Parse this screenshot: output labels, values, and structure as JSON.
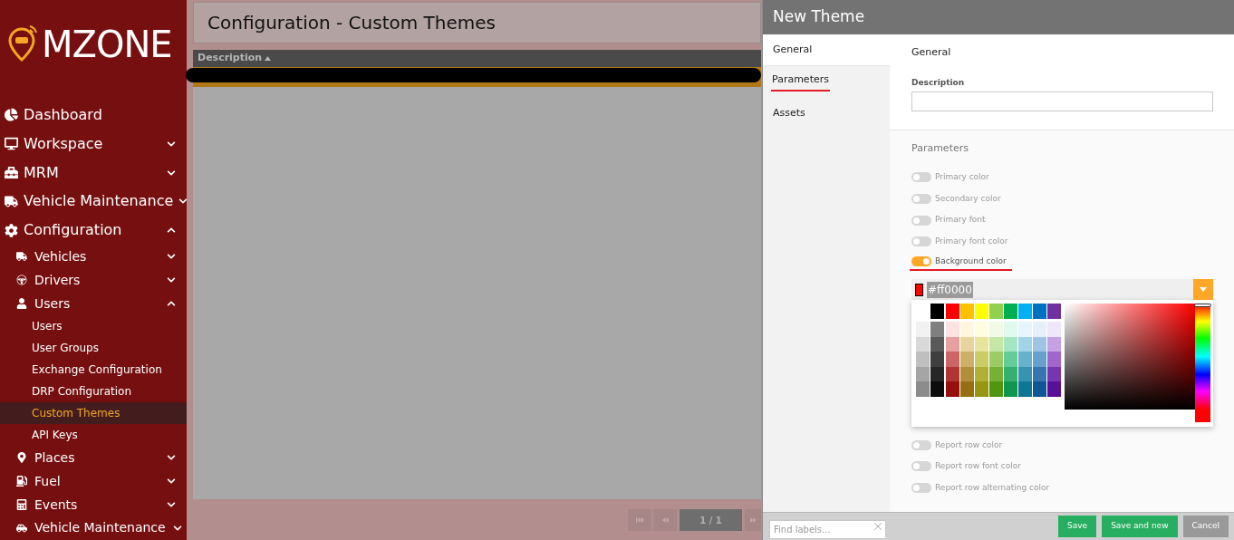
{
  "logo": {
    "text": "MZONE"
  },
  "sidebar": {
    "items": [
      {
        "label": "Dashboard",
        "selected": false
      },
      {
        "label": "Workspace",
        "expanded": false,
        "selected": false
      },
      {
        "label": "MRM",
        "expanded": false,
        "selected": false
      },
      {
        "label": "Vehicle Maintenance",
        "expanded": false,
        "selected": false
      },
      {
        "label": "Configuration",
        "expanded": true,
        "selected": false,
        "children": [
          {
            "label": "Vehicles",
            "expanded": false,
            "selected": false
          },
          {
            "label": "Drivers",
            "expanded": false,
            "selected": false
          },
          {
            "label": "Users",
            "expanded": true,
            "selected": false,
            "children": [
              {
                "label": "Users",
                "selected": false
              },
              {
                "label": "User Groups",
                "selected": false
              },
              {
                "label": "Exchange Configuration",
                "selected": false
              },
              {
                "label": "DRP Configuration",
                "selected": false
              },
              {
                "label": "Custom Themes",
                "selected": true
              },
              {
                "label": "API Keys",
                "selected": false
              }
            ]
          },
          {
            "label": "Places",
            "expanded": false,
            "selected": false
          },
          {
            "label": "Fuel",
            "expanded": false,
            "selected": false
          },
          {
            "label": "Events",
            "expanded": false,
            "selected": false
          },
          {
            "label": "Vehicle Maintenance",
            "expanded": false,
            "selected": false
          }
        ]
      }
    ]
  },
  "page": {
    "title": "Configuration - Custom Themes",
    "table": {
      "columns": [
        {
          "label": "Description",
          "sorted": true
        }
      ]
    },
    "pagination": {
      "page": "1 / 1"
    }
  },
  "dialog": {
    "title": "New Theme",
    "tabs": [
      {
        "label": "General",
        "selected": true,
        "underlined": false
      },
      {
        "label": "Parameters",
        "selected": false,
        "underlined": true
      },
      {
        "label": "Assets",
        "selected": false,
        "underlined": false
      }
    ],
    "general": {
      "heading": "General",
      "description": {
        "label": "Description"
      }
    },
    "parameters": {
      "heading": "Parameters",
      "items": [
        {
          "label": "Primary color",
          "on": false,
          "underlined": false
        },
        {
          "label": "Secondary color",
          "on": false,
          "underlined": false
        },
        {
          "label": "Primary font",
          "on": false,
          "underlined": false
        },
        {
          "label": "Primary font color",
          "on": false,
          "underlined": false
        },
        {
          "label": "Background color",
          "on": true,
          "underlined": true,
          "picker": {
            "value": "#ff0000",
            "hue": {
              "level": 0
            },
            "palette": [
              [
                {
                  "color": "#000000"
                },
                {
                  "color": "#ff0000"
                },
                {
                  "color": "#ffc000"
                },
                {
                  "color": "#ffff00"
                },
                {
                  "color": "#92d050"
                },
                {
                  "color": "#00b050"
                },
                {
                  "color": "#00b0f0"
                },
                {
                  "color": "#0070c0"
                },
                {
                  "color": "#7030a0"
                }
              ],
              [
                {
                  "color": "#f2f2f2"
                },
                {
                  "color": "#7f7f7f"
                },
                {
                  "color": "#fde2e2"
                },
                {
                  "color": "#fff6e0"
                },
                {
                  "color": "#fffde0"
                },
                {
                  "color": "#f0fae6"
                },
                {
                  "color": "#e0faee"
                },
                {
                  "color": "#e6f6fc"
                },
                {
                  "color": "#e6f0fa"
                },
                {
                  "color": "#f0e6fa"
                }
              ],
              [
                {
                  "color": "#d9d9d9"
                },
                {
                  "color": "#595959"
                },
                {
                  "color": "#e6a0a0"
                },
                {
                  "color": "#e8d49e"
                },
                {
                  "color": "#e6e59e"
                },
                {
                  "color": "#c6e6a4"
                },
                {
                  "color": "#a4e6c4"
                },
                {
                  "color": "#a0d4e6"
                },
                {
                  "color": "#a0c4e4"
                },
                {
                  "color": "#c8a0e4"
                }
              ],
              [
                {
                  "color": "#bfbfbf"
                },
                {
                  "color": "#3f3f3f"
                },
                {
                  "color": "#cc6666"
                },
                {
                  "color": "#ccb066"
                },
                {
                  "color": "#cccc66"
                },
                {
                  "color": "#9ccc66"
                },
                {
                  "color": "#66cc96"
                },
                {
                  "color": "#66b2cc"
                },
                {
                  "color": "#66a0cc"
                },
                {
                  "color": "#a066cc"
                }
              ],
              [
                {
                  "color": "#a5a5a5"
                },
                {
                  "color": "#262626"
                },
                {
                  "color": "#b03636"
                },
                {
                  "color": "#b08f36"
                },
                {
                  "color": "#b0b036"
                },
                {
                  "color": "#76b036"
                },
                {
                  "color": "#36b06e"
                },
                {
                  "color": "#3694b0"
                },
                {
                  "color": "#3676b0"
                },
                {
                  "color": "#7636b0"
                }
              ],
              [
                {
                  "color": "#8c8c8c"
                },
                {
                  "color": "#0c0c0c"
                },
                {
                  "color": "#961010"
                },
                {
                  "color": "#967010"
                },
                {
                  "color": "#969610"
                },
                {
                  "color": "#529610"
                },
                {
                  "color": "#10964e"
                },
                {
                  "color": "#107696"
                },
                {
                  "color": "#105696"
                },
                {
                  "color": "#5a1096"
                }
              ]
            ]
          }
        },
        {
          "label": "Report row color",
          "on": false,
          "underlined": false
        },
        {
          "label": "Report row font color",
          "on": false,
          "underlined": false
        },
        {
          "label": "Report row alternating color",
          "on": false,
          "underlined": false
        }
      ]
    },
    "footer": {
      "search": {
        "placeholder": "Find labels..."
      },
      "buttons": [
        {
          "label": "Save",
          "kind": "primary"
        },
        {
          "label": "Save and new",
          "kind": "primary"
        },
        {
          "label": "Cancel",
          "kind": "secondary"
        }
      ]
    }
  }
}
